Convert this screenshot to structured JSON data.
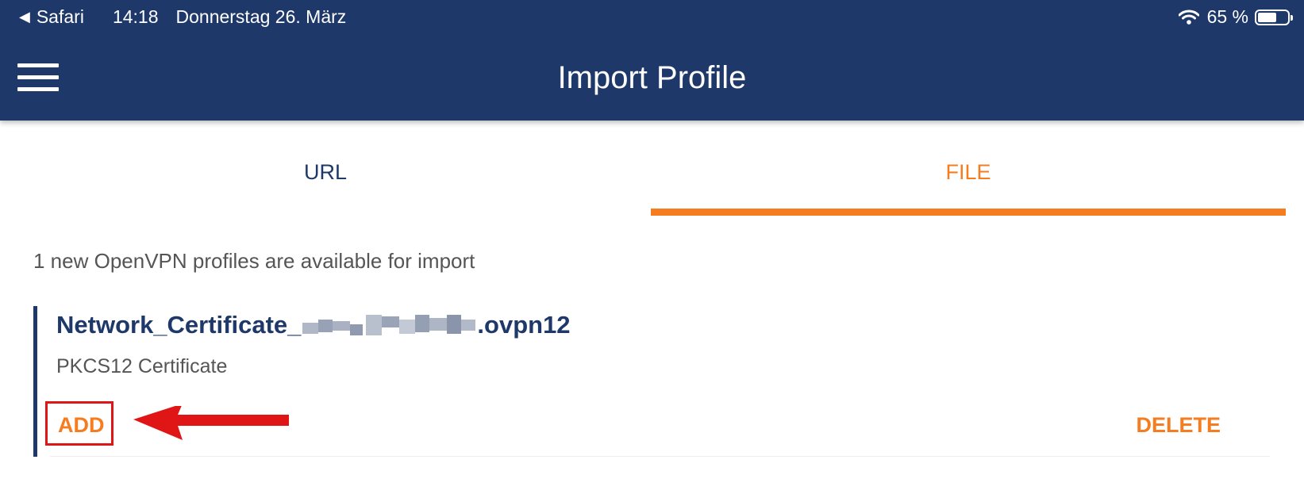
{
  "status_bar": {
    "back_label": "Safari",
    "time": "14:18",
    "date": "Donnerstag 26. März",
    "battery_percent": "65 %",
    "battery_level": 0.65,
    "icons": [
      "back-arrow-icon",
      "wifi-icon",
      "battery-icon"
    ]
  },
  "header": {
    "title": "Import Profile",
    "menu_icon": "hamburger-menu-icon"
  },
  "tabs": [
    {
      "label": "URL",
      "selected": false
    },
    {
      "label": "FILE",
      "selected": true
    }
  ],
  "info_text": "1 new OpenVPN profiles are available for import",
  "profile": {
    "name_prefix": "Network_Certificate_",
    "name_suffix": ".ovpn12",
    "type": "PKCS12 Certificate",
    "add_label": "ADD",
    "delete_label": "DELETE"
  },
  "colors": {
    "header_bg": "#1e3869",
    "accent": "#f57c1f",
    "annotation": "#e01515"
  }
}
